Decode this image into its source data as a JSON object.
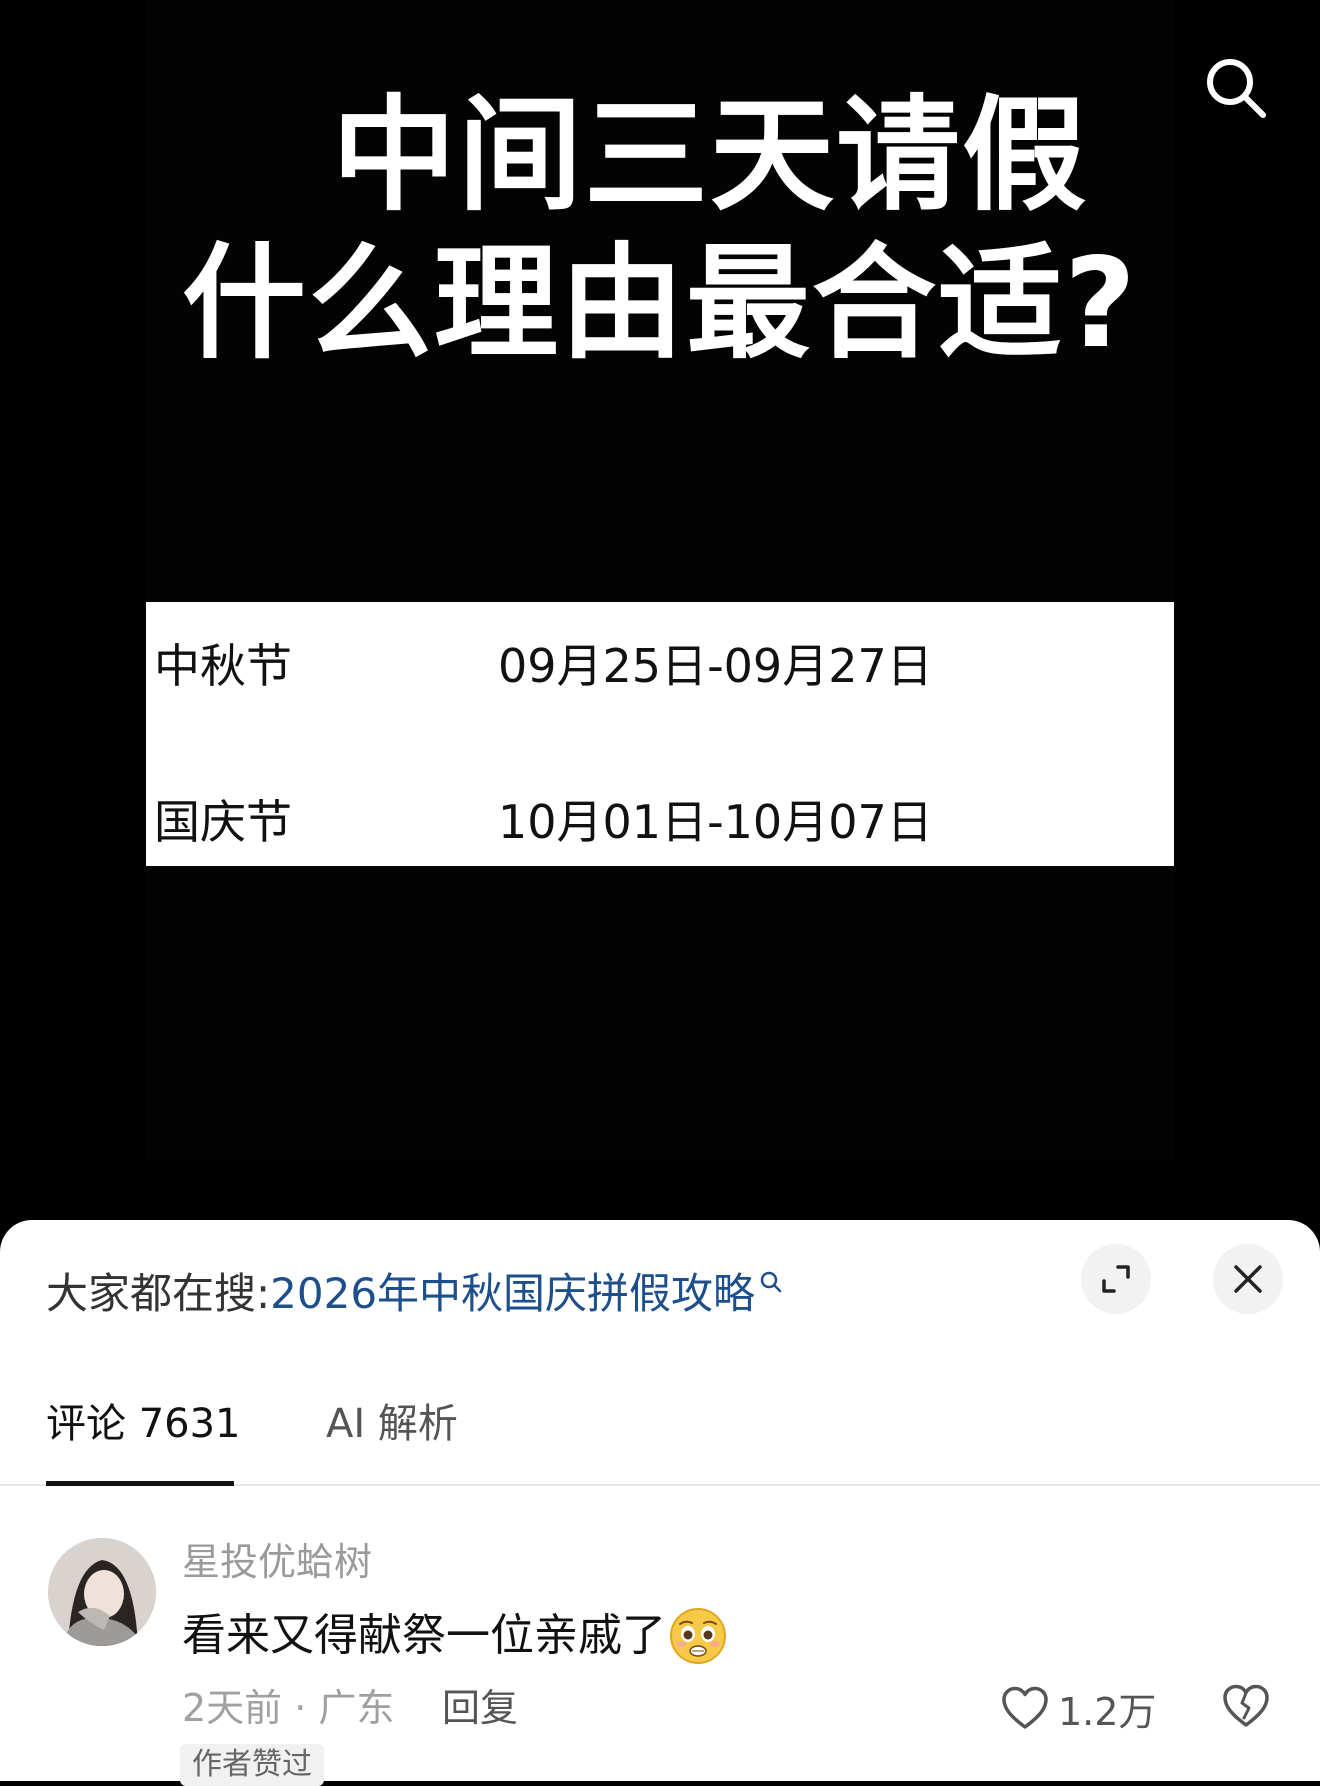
{
  "video": {
    "headline_line1": "中间三天请假",
    "headline_line2": "什么理由最合适?",
    "holidays": [
      {
        "name": "中秋节",
        "dates": "09月25日-09月27日"
      },
      {
        "name": "国庆节",
        "dates": "10月01日-10月07日"
      }
    ],
    "search_icon": "search-icon"
  },
  "sheet": {
    "hot_search_prefix": "大家都在搜:",
    "hot_search_topic": "2026年中秋国庆拼假攻略",
    "expand_icon": "expand-icon",
    "close_icon": "close-icon",
    "tabs": [
      {
        "label": "评论 7631",
        "active": true
      },
      {
        "label": "AI 解析",
        "active": false
      }
    ],
    "comments": [
      {
        "username": "星投优蛤树",
        "text": "看来又得献祭一位亲戚了",
        "emoji": "pleading-face-emoji",
        "meta": "2天前 · 广东",
        "reply_label": "回复",
        "like_count": "1.2万",
        "badge": "作者赞过"
      }
    ]
  },
  "colors": {
    "background": "#000000",
    "sheet": "#ffffff",
    "link": "#1d4f8c",
    "muted": "#9a9a9a"
  }
}
